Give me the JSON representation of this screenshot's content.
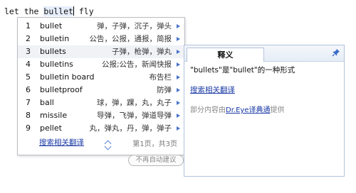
{
  "editor": {
    "text_before": "let the ",
    "highlighted_word": "bullet",
    "text_after": " fly"
  },
  "suggestions": {
    "items": [
      {
        "num": "1",
        "word": "bullet",
        "meaning": "弹，子弹，沉子，弹头"
      },
      {
        "num": "2",
        "word": "bulletin",
        "meaning": "公告，公报，通报，简报"
      },
      {
        "num": "3",
        "word": "bullets",
        "meaning": "子弹，枪弹，弹丸"
      },
      {
        "num": "4",
        "word": "bulletins",
        "meaning": "公报;公告，新闻快报"
      },
      {
        "num": "5",
        "word": "bulletin board",
        "meaning": "布告栏"
      },
      {
        "num": "6",
        "word": "bulletproof",
        "meaning": "防弹"
      },
      {
        "num": "7",
        "word": "ball",
        "meaning": "球，弹，踝，丸，丸子"
      },
      {
        "num": "8",
        "word": "missile",
        "meaning": "导弹，飞弹，弹道导弹"
      },
      {
        "num": "9",
        "word": "pellet",
        "meaning": "丸，弹丸，丹，弹，弹子"
      }
    ],
    "selected_index": 2,
    "search_link": "搜索相关翻译",
    "page_info": "第1页，共3页",
    "arrow_color": "#4a73c9"
  },
  "no_suggest_button": "不再自动建议",
  "panel": {
    "tab_label": "释义",
    "definition": "\"bullets\"是\"bullet\"的一种形式",
    "search_link": "搜索相关翻译",
    "credit_prefix": "部分内容由",
    "credit_link": "Dr.Eye译典通",
    "credit_suffix": "提供",
    "pin_icon": "pin-icon"
  }
}
